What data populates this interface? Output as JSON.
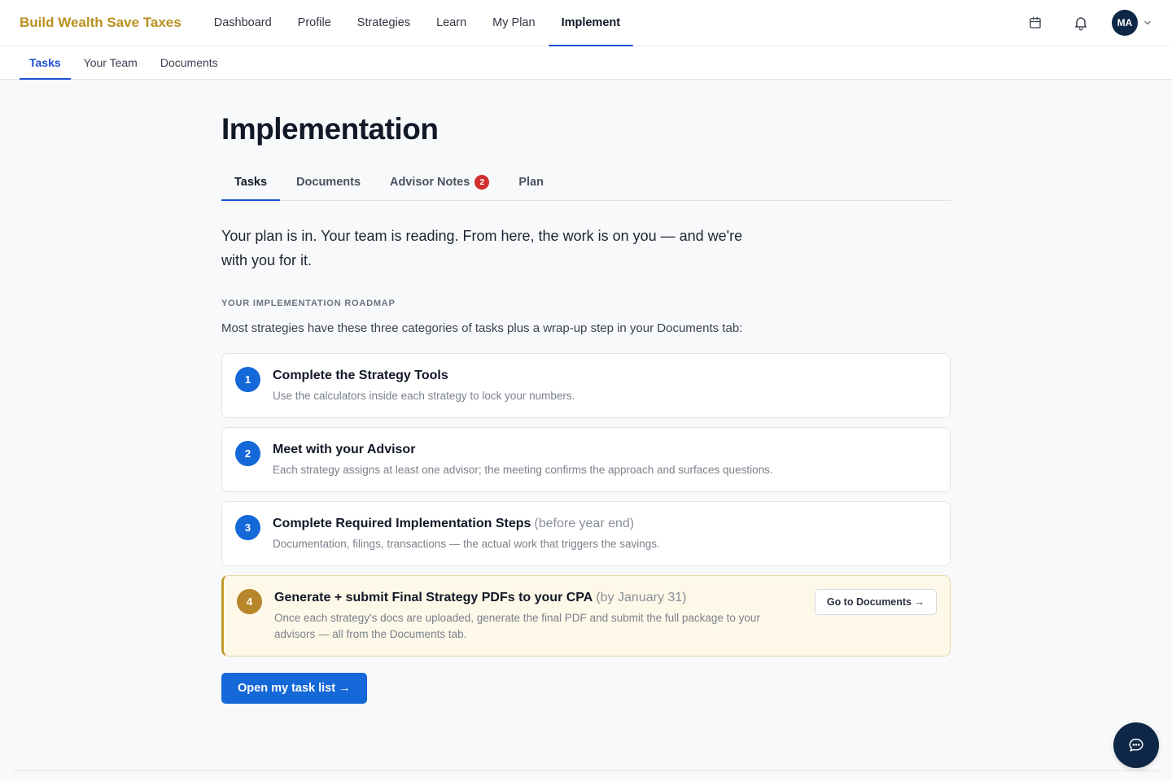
{
  "brand": "Build Wealth Save Taxes",
  "nav": {
    "items": [
      {
        "label": "Dashboard"
      },
      {
        "label": "Profile"
      },
      {
        "label": "Strategies"
      },
      {
        "label": "Learn"
      },
      {
        "label": "My Plan"
      },
      {
        "label": "Implement",
        "active": true
      }
    ],
    "user_initials": "MA"
  },
  "subnav": {
    "items": [
      {
        "label": "Tasks",
        "active": true
      },
      {
        "label": "Your Team"
      },
      {
        "label": "Documents"
      }
    ]
  },
  "page": {
    "title": "Implementation",
    "tabs": [
      {
        "label": "Tasks",
        "active": true
      },
      {
        "label": "Documents"
      },
      {
        "label": "Advisor Notes",
        "badge": "2"
      },
      {
        "label": "Plan"
      }
    ],
    "intro": "Your plan is in. Your team is reading. From here, the work is on you — and we're with you for it.",
    "roadmap_label": "YOUR IMPLEMENTATION ROADMAP",
    "roadmap_desc": "Most strategies have these three categories of tasks plus a wrap-up step in your Documents tab:",
    "steps": [
      {
        "num": "1",
        "title": "Complete the Strategy Tools",
        "note": "",
        "desc": "Use the calculators inside each strategy to lock your numbers."
      },
      {
        "num": "2",
        "title": "Meet with your Advisor",
        "note": "",
        "desc": "Each strategy assigns at least one advisor; the meeting confirms the approach and surfaces questions."
      },
      {
        "num": "3",
        "title": "Complete Required Implementation Steps",
        "note": "(before year end)",
        "desc": "Documentation, filings, transactions — the actual work that triggers the savings."
      },
      {
        "num": "4",
        "title": "Generate + submit Final Strategy PDFs to your CPA",
        "note": "(by January 31)",
        "desc": "Once each strategy's docs are uploaded, generate the final PDF and submit the full package to your advisors — all from the Documents tab.",
        "button": "Go to Documents →"
      }
    ],
    "primary_button": "Open my task list →"
  },
  "colors": {
    "brand": "#b8901f",
    "accent": "#1468d8",
    "final_step": "#b8862a",
    "badge": "#d12f2f"
  }
}
